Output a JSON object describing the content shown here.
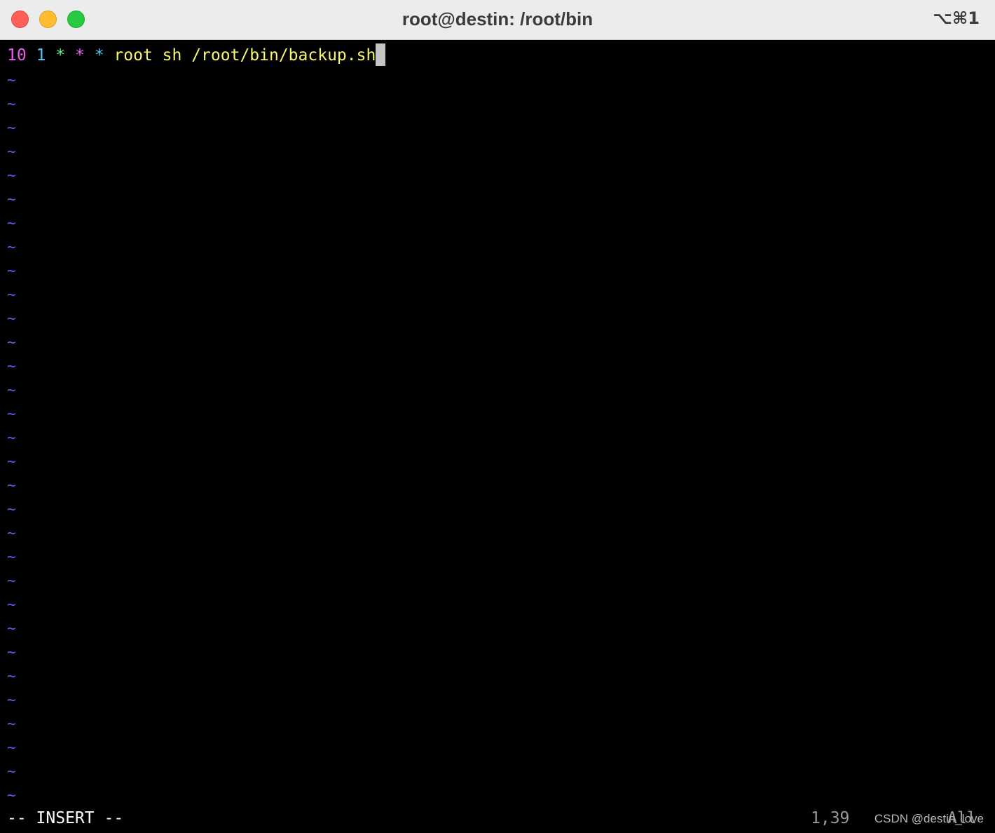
{
  "window": {
    "title": "root@destin: /root/bin",
    "shortcut": "⌥⌘1"
  },
  "editor": {
    "line1": {
      "minute": "10",
      "hour": "1",
      "dom": "*",
      "month": "*",
      "dow": "*",
      "command": "root sh /root/bin/backup.sh"
    },
    "empty_line_marker": "~",
    "empty_line_count": 31,
    "colors": {
      "background": "#000000",
      "tilde": "#5b5bf2",
      "minute": "#ee5cf0",
      "hour": "#4fc7f6",
      "dom": "#5df08f",
      "month": "#ee5cf0",
      "dow": "#4fc7f6",
      "command": "#f8f86a"
    }
  },
  "statusline": {
    "mode": "-- INSERT --",
    "position": "1,39",
    "percent": "All"
  },
  "watermark": "CSDN @destin_love"
}
